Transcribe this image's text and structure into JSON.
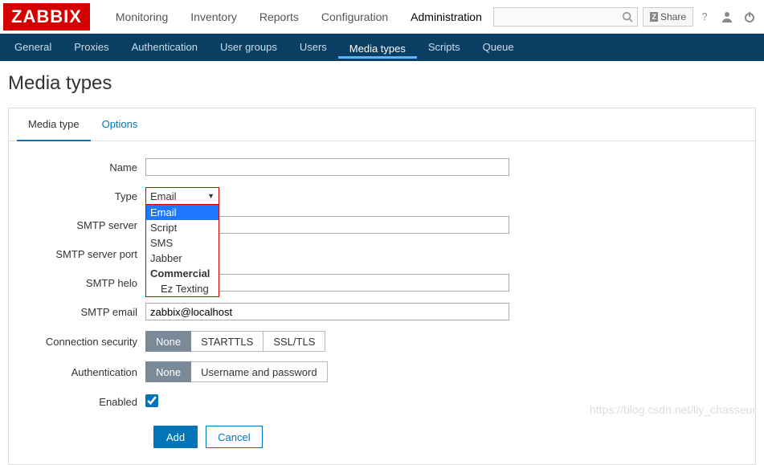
{
  "logo": "ZABBIX",
  "main_nav": [
    "Monitoring",
    "Inventory",
    "Reports",
    "Configuration",
    "Administration"
  ],
  "main_nav_active": 4,
  "share": "Share",
  "sub_nav": [
    "General",
    "Proxies",
    "Authentication",
    "User groups",
    "Users",
    "Media types",
    "Scripts",
    "Queue"
  ],
  "sub_nav_active": 5,
  "page_title": "Media types",
  "tabs": [
    "Media type",
    "Options"
  ],
  "tabs_active": 0,
  "form": {
    "name": {
      "label": "Name",
      "value": ""
    },
    "type": {
      "label": "Type",
      "value": "Email",
      "options": [
        "Email",
        "Script",
        "SMS",
        "Jabber"
      ],
      "group_label": "Commercial",
      "group_items": [
        "Ez Texting"
      ],
      "selected": 0
    },
    "smtp_server": {
      "label": "SMTP server",
      "value": ""
    },
    "smtp_port": {
      "label": "SMTP server port",
      "value": ""
    },
    "smtp_helo": {
      "label": "SMTP helo",
      "value": ""
    },
    "smtp_email": {
      "label": "SMTP email",
      "value": "zabbix@localhost"
    },
    "conn_sec": {
      "label": "Connection security",
      "options": [
        "None",
        "STARTTLS",
        "SSL/TLS"
      ],
      "selected": 0
    },
    "auth": {
      "label": "Authentication",
      "options": [
        "None",
        "Username and password"
      ],
      "selected": 0
    },
    "enabled": {
      "label": "Enabled",
      "checked": true
    }
  },
  "actions": {
    "add": "Add",
    "cancel": "Cancel"
  },
  "watermark": "https://blog.csdn.net/liy_chasseur"
}
